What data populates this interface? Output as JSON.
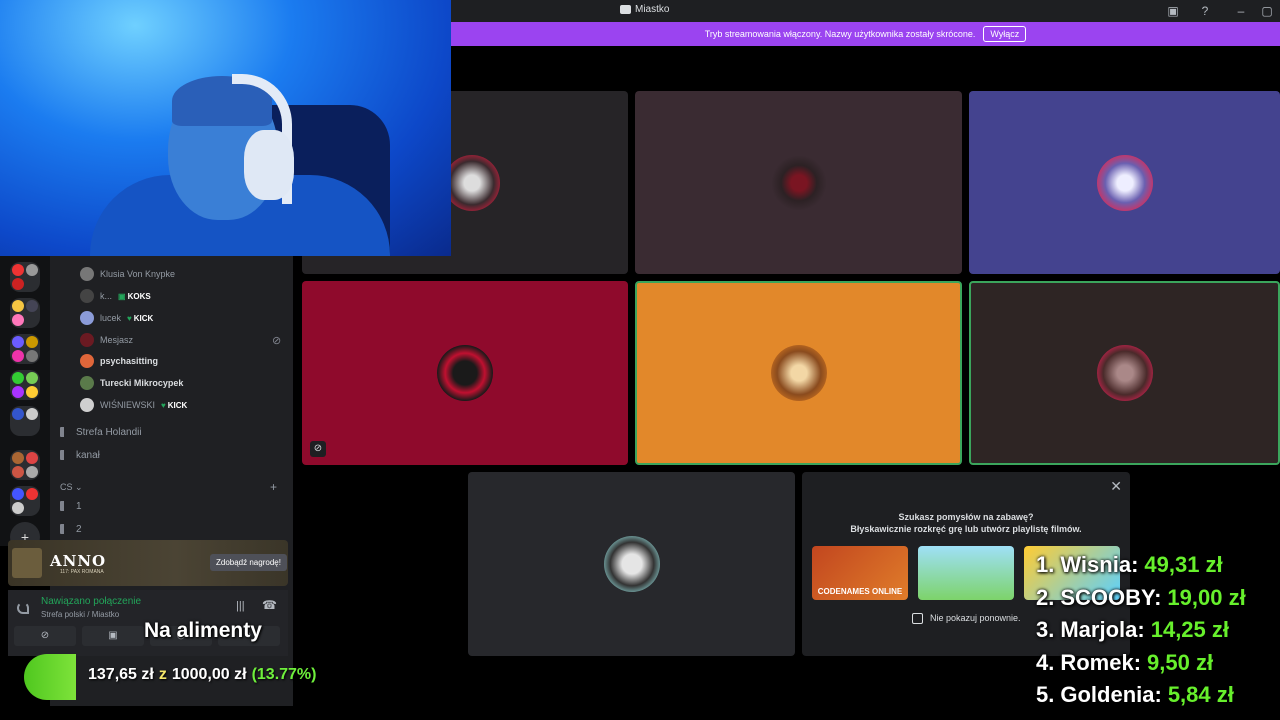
{
  "titlebar": {
    "title": "Miastko"
  },
  "banner": {
    "text": "Tryb streamowania włączony. Nazwy użytkownika zostały skrócone.",
    "button": "Wyłącz"
  },
  "voice_users": [
    {
      "name": "Klusia Von Knypke",
      "badge": "",
      "bright": false
    },
    {
      "name": "k...",
      "badge": "KOKS",
      "bright": false
    },
    {
      "name": "lucek",
      "badge": "KICK",
      "bright": false
    },
    {
      "name": "Mesjasz",
      "badge": "",
      "bright": false
    },
    {
      "name": "psychasitting",
      "badge": "",
      "bright": true
    },
    {
      "name": "Turecki Mikrocypek",
      "badge": "",
      "bright": true
    },
    {
      "name": "WIŚNIEWSKI",
      "badge": "KICK",
      "bright": false
    }
  ],
  "channels": [
    "Strefa Holandii",
    "kanał"
  ],
  "category": {
    "name": "CS",
    "items": [
      "1",
      "2"
    ]
  },
  "promo": {
    "title": "ANNO",
    "subtitle": "117: PAX ROMANA",
    "button": "Zdobądź nagrodę!"
  },
  "voice_panel": {
    "status": "Nawiązano połączenie",
    "location": "Strefa polski / Miastko"
  },
  "activity": {
    "line1": "Szukasz pomysłów na zabawę?",
    "line2": "Błyskawicznie rozkręć grę lub utwórz playlistę filmów.",
    "games": [
      "CODENAMES ONLINE",
      "",
      ""
    ],
    "checkbox": "Nie pokazuj ponownie."
  },
  "overlay": {
    "goal_title": "Na alimenty",
    "goal_current": "137,65 zł",
    "goal_sep": "z",
    "goal_target": "1000,00 zł",
    "goal_percent": "(13.77%)",
    "goal_progress": 0.1377
  },
  "leaderboard": [
    {
      "rank": "1.",
      "name": "Wisnia:",
      "amount": "49,31 zł"
    },
    {
      "rank": "2.",
      "name": "SCOOBY:",
      "amount": "19,00 zł"
    },
    {
      "rank": "3.",
      "name": "Marjola:",
      "amount": "14,25 zł"
    },
    {
      "rank": "4.",
      "name": "Romek:",
      "amount": "9,50 zł"
    },
    {
      "rank": "5.",
      "name": "Goldenia:",
      "amount": "5,84 zł"
    }
  ],
  "colors": {
    "banner": "#9b44f0",
    "speaking": "#3ba55c",
    "goal_green": "#6ff03c"
  }
}
